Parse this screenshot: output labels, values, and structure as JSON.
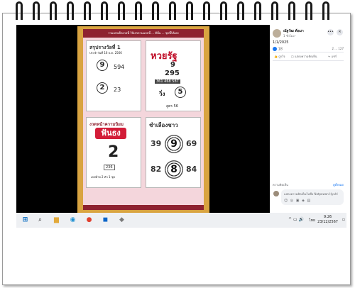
{
  "poster": {
    "banner": "รวมเลขเด็ดงวดนี้ ใช้เลขรวมแบบนี้ ... ดีนั้น ... ชุดนี้ได้เลย",
    "card1": {
      "title": "สรุปรางวัลที่ 1",
      "date_line": "ประจำวันที่ 16 ธ.ค. 2566",
      "circle_a": "9",
      "num_a": "594",
      "circle_b": "2",
      "num_b": "23"
    },
    "card2": {
      "title": "หวยรัฐ",
      "top_digit": "9",
      "top_number": "295",
      "row_small": "361 468 587",
      "side_label": "วิ่ง",
      "circle": "5",
      "footnote": "สูตร 56"
    },
    "card3": {
      "title": "งวดหน้าความนิยม",
      "badge": "ฟันธง",
      "digit": "2",
      "small": "236",
      "footnote": "เลขท้าย 2 ตัว 1 ชุด"
    },
    "card4": {
      "title": "ชำเลืองชาว",
      "left_top": "39",
      "center_top": "9",
      "right_top": "69",
      "left_bottom": "82",
      "center_bottom": "8",
      "right_bottom": "84"
    }
  },
  "facebook": {
    "author_name": "ณัฐวัฒ ต้อมา",
    "meta": "1 ชั่วโมง · ",
    "caption": "1/1/2025",
    "reaction_count": "18",
    "counts_text": "2 ... 127",
    "actions": [
      "ถูกใจ",
      "แสดงความคิดเห็น",
      "แชร์"
    ],
    "more_comments": "ความคิดเห็น",
    "relevant_label": "ดูทั้งหมด",
    "comment_placeholder": "แสดงความคิดเห็นในชื่อ Natpawan Hyuhl"
  },
  "taskbar": {
    "tray_arrow": "^",
    "lang": "ไทย",
    "time": "9:26",
    "date": "23/12/2567"
  },
  "icons": {
    "windows": "windows-icon",
    "search": "search-icon",
    "files": "file-explorer-icon",
    "edge": "edge-icon",
    "chrome": "chrome-icon",
    "outlook": "outlook-icon"
  }
}
